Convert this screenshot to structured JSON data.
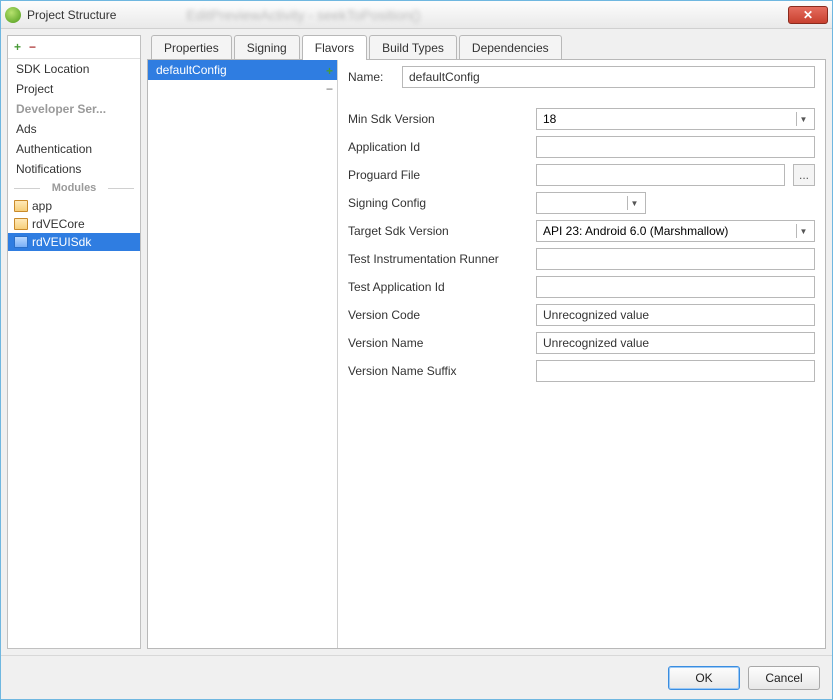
{
  "window": {
    "title": "Project Structure",
    "blurred_context": "EditPreviewActivity - seekToPosition()"
  },
  "sidebar": {
    "items": [
      {
        "label": "SDK Location",
        "type": "normal"
      },
      {
        "label": "Project",
        "type": "normal"
      },
      {
        "label": "Developer Ser...",
        "type": "gray"
      },
      {
        "label": "Ads",
        "type": "normal"
      },
      {
        "label": "Authentication",
        "type": "normal"
      },
      {
        "label": "Notifications",
        "type": "normal"
      }
    ],
    "modules_header": "Modules",
    "modules": [
      {
        "label": "app",
        "selected": false
      },
      {
        "label": "rdVECore",
        "selected": false
      },
      {
        "label": "rdVEUISdk",
        "selected": true
      }
    ]
  },
  "tabs": [
    {
      "label": "Properties",
      "active": false
    },
    {
      "label": "Signing",
      "active": false
    },
    {
      "label": "Flavors",
      "active": true
    },
    {
      "label": "Build Types",
      "active": false
    },
    {
      "label": "Dependencies",
      "active": false
    }
  ],
  "flavors": {
    "items": [
      "defaultConfig"
    ],
    "selected": "defaultConfig"
  },
  "form": {
    "name_label": "Name:",
    "name_value": "defaultConfig",
    "fields": [
      {
        "label": "Min Sdk Version",
        "value": "18",
        "kind": "select"
      },
      {
        "label": "Application Id",
        "value": "",
        "kind": "text"
      },
      {
        "label": "Proguard File",
        "value": "",
        "kind": "browse"
      },
      {
        "label": "Signing Config",
        "value": "",
        "kind": "select-narrow"
      },
      {
        "label": "Target Sdk Version",
        "value": "API 23: Android 6.0 (Marshmallow)",
        "kind": "select"
      },
      {
        "label": "Test Instrumentation Runner",
        "value": "",
        "kind": "text"
      },
      {
        "label": "Test Application Id",
        "value": "",
        "kind": "text"
      },
      {
        "label": "Version Code",
        "value": "Unrecognized value",
        "kind": "text"
      },
      {
        "label": "Version Name",
        "value": "Unrecognized value",
        "kind": "text"
      },
      {
        "label": "Version Name Suffix",
        "value": "",
        "kind": "text"
      }
    ]
  },
  "footer": {
    "ok": "OK",
    "cancel": "Cancel"
  },
  "icons": {
    "plus": "+",
    "minus": "−",
    "close": "✕",
    "chevron": "▼",
    "ellipsis": "..."
  }
}
